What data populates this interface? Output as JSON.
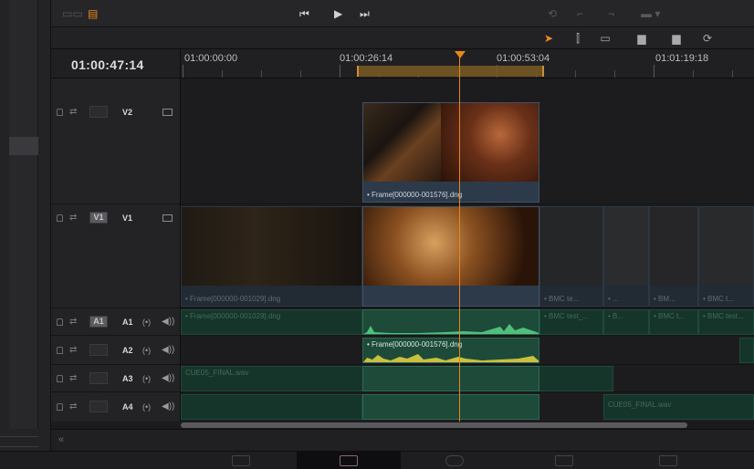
{
  "timecode": "01:00:47:14",
  "ruler": {
    "labels": [
      "01:00:00:00",
      "01:00:26:14",
      "01:00:53:04",
      "01:01:19:18"
    ]
  },
  "tracks": {
    "v2": {
      "name": "V2"
    },
    "v1": {
      "name": "V1",
      "dest": "V1"
    },
    "a1": {
      "name": "A1",
      "dest": "A1"
    },
    "a2": {
      "name": "A2"
    },
    "a3": {
      "name": "A3"
    },
    "a4": {
      "name": "A4"
    }
  },
  "clips": {
    "v2_clip": "• Frame[000000-001576].dng",
    "v1_left": "• Frame[000000-001029].dng",
    "v1_r1": "• BMC te...",
    "v1_r2": "• ...",
    "v1_r3": "• BM...",
    "v1_r4": "• BMC t...",
    "a1_left": "• Frame[000000-001029].dng",
    "a1_r1": "• BMC test_...",
    "a1_r2": "• B...",
    "a1_r3": "• BMC t...",
    "a1_r4": "• BMC test...",
    "a2_clip": "• Frame[000000-001576].dng",
    "a3_clip": "CUE05_FINAL.wav",
    "a4_clip": "CUE05_FINAL.wav"
  },
  "icons": {
    "pointer": "arrow-icon",
    "trim": "trim-icon",
    "blade": "blade-icon"
  },
  "colors": {
    "playhead": "#e8851e",
    "video_clip": "#2c3a4a",
    "audio_clip": "#1e4a3a"
  }
}
